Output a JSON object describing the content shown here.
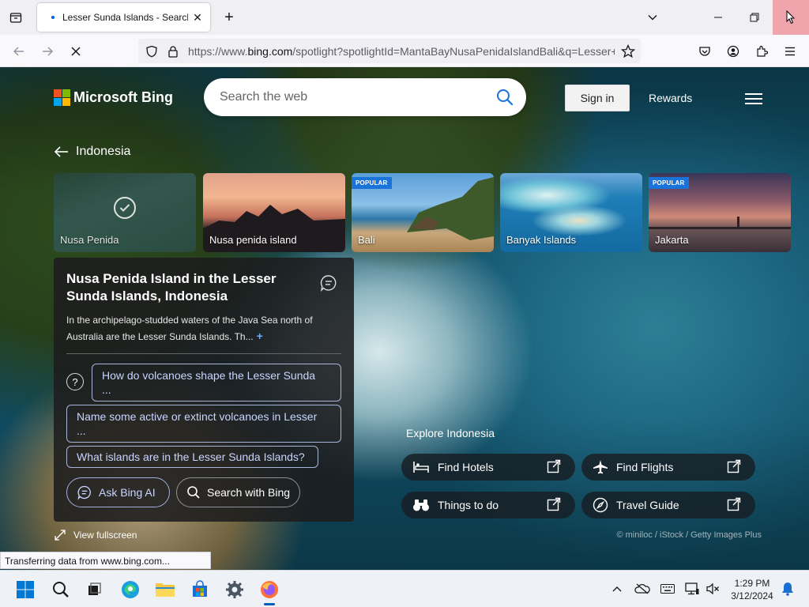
{
  "browser": {
    "tab_title": "Lesser Sunda Islands - Search",
    "url_prefix": "https://www.",
    "url_host": "bing.com",
    "url_rest": "/spotlight?spotlightId=MantaBayNusaPenidaIslandBali&q=Lesser+",
    "status_text": "Transferring data from www.bing.com..."
  },
  "header": {
    "logo_text": "Microsoft Bing",
    "search_placeholder": "Search the web",
    "sign_in_label": "Sign in",
    "rewards_label": "Rewards"
  },
  "location": {
    "back_label": "Indonesia"
  },
  "carousel": [
    {
      "label": "Nusa Penida",
      "badge": "",
      "selected": true
    },
    {
      "label": "Nusa penida island",
      "badge": "",
      "selected": false
    },
    {
      "label": "Bali",
      "badge": "POPULAR",
      "selected": false
    },
    {
      "label": "Banyak Islands",
      "badge": "",
      "selected": false
    },
    {
      "label": "Jakarta",
      "badge": "POPULAR",
      "selected": false
    }
  ],
  "panel": {
    "title": "Nusa Penida Island in the Lesser Sunda Islands, Indonesia",
    "description": "In the archipelago-studded waters of the Java Sea north of Australia are the Lesser Sunda Islands. Th...",
    "more_symbol": "+",
    "questions": [
      {
        "text": "How do volcanoes shape the Lesser Sunda",
        "more": "..."
      },
      {
        "text": "Name some active or extinct volcanoes in Lesser",
        "more": "..."
      },
      {
        "text": "What islands are in the Lesser Sunda Islands?",
        "more": ""
      }
    ],
    "question_icon": "?",
    "ask_bing_label": "Ask Bing AI",
    "search_bing_label": "Search with Bing"
  },
  "fullscreen_label": "View fullscreen",
  "explore": {
    "title": "Explore Indonesia",
    "links": [
      {
        "label": "Find Hotels",
        "icon": "bed-icon"
      },
      {
        "label": "Find Flights",
        "icon": "plane-icon"
      },
      {
        "label": "Things to do",
        "icon": "binoculars-icon"
      },
      {
        "label": "Travel Guide",
        "icon": "compass-icon"
      }
    ]
  },
  "image_credit": "© miniloc / iStock / Getty Images Plus",
  "taskbar": {
    "time": "1:29 PM",
    "date": "3/12/2024"
  },
  "colors": {
    "ms_red": "#f25022",
    "ms_green": "#7fba00",
    "ms_blue": "#00a4ef",
    "ms_yellow": "#ffb900",
    "accent": "#1a73d9"
  }
}
